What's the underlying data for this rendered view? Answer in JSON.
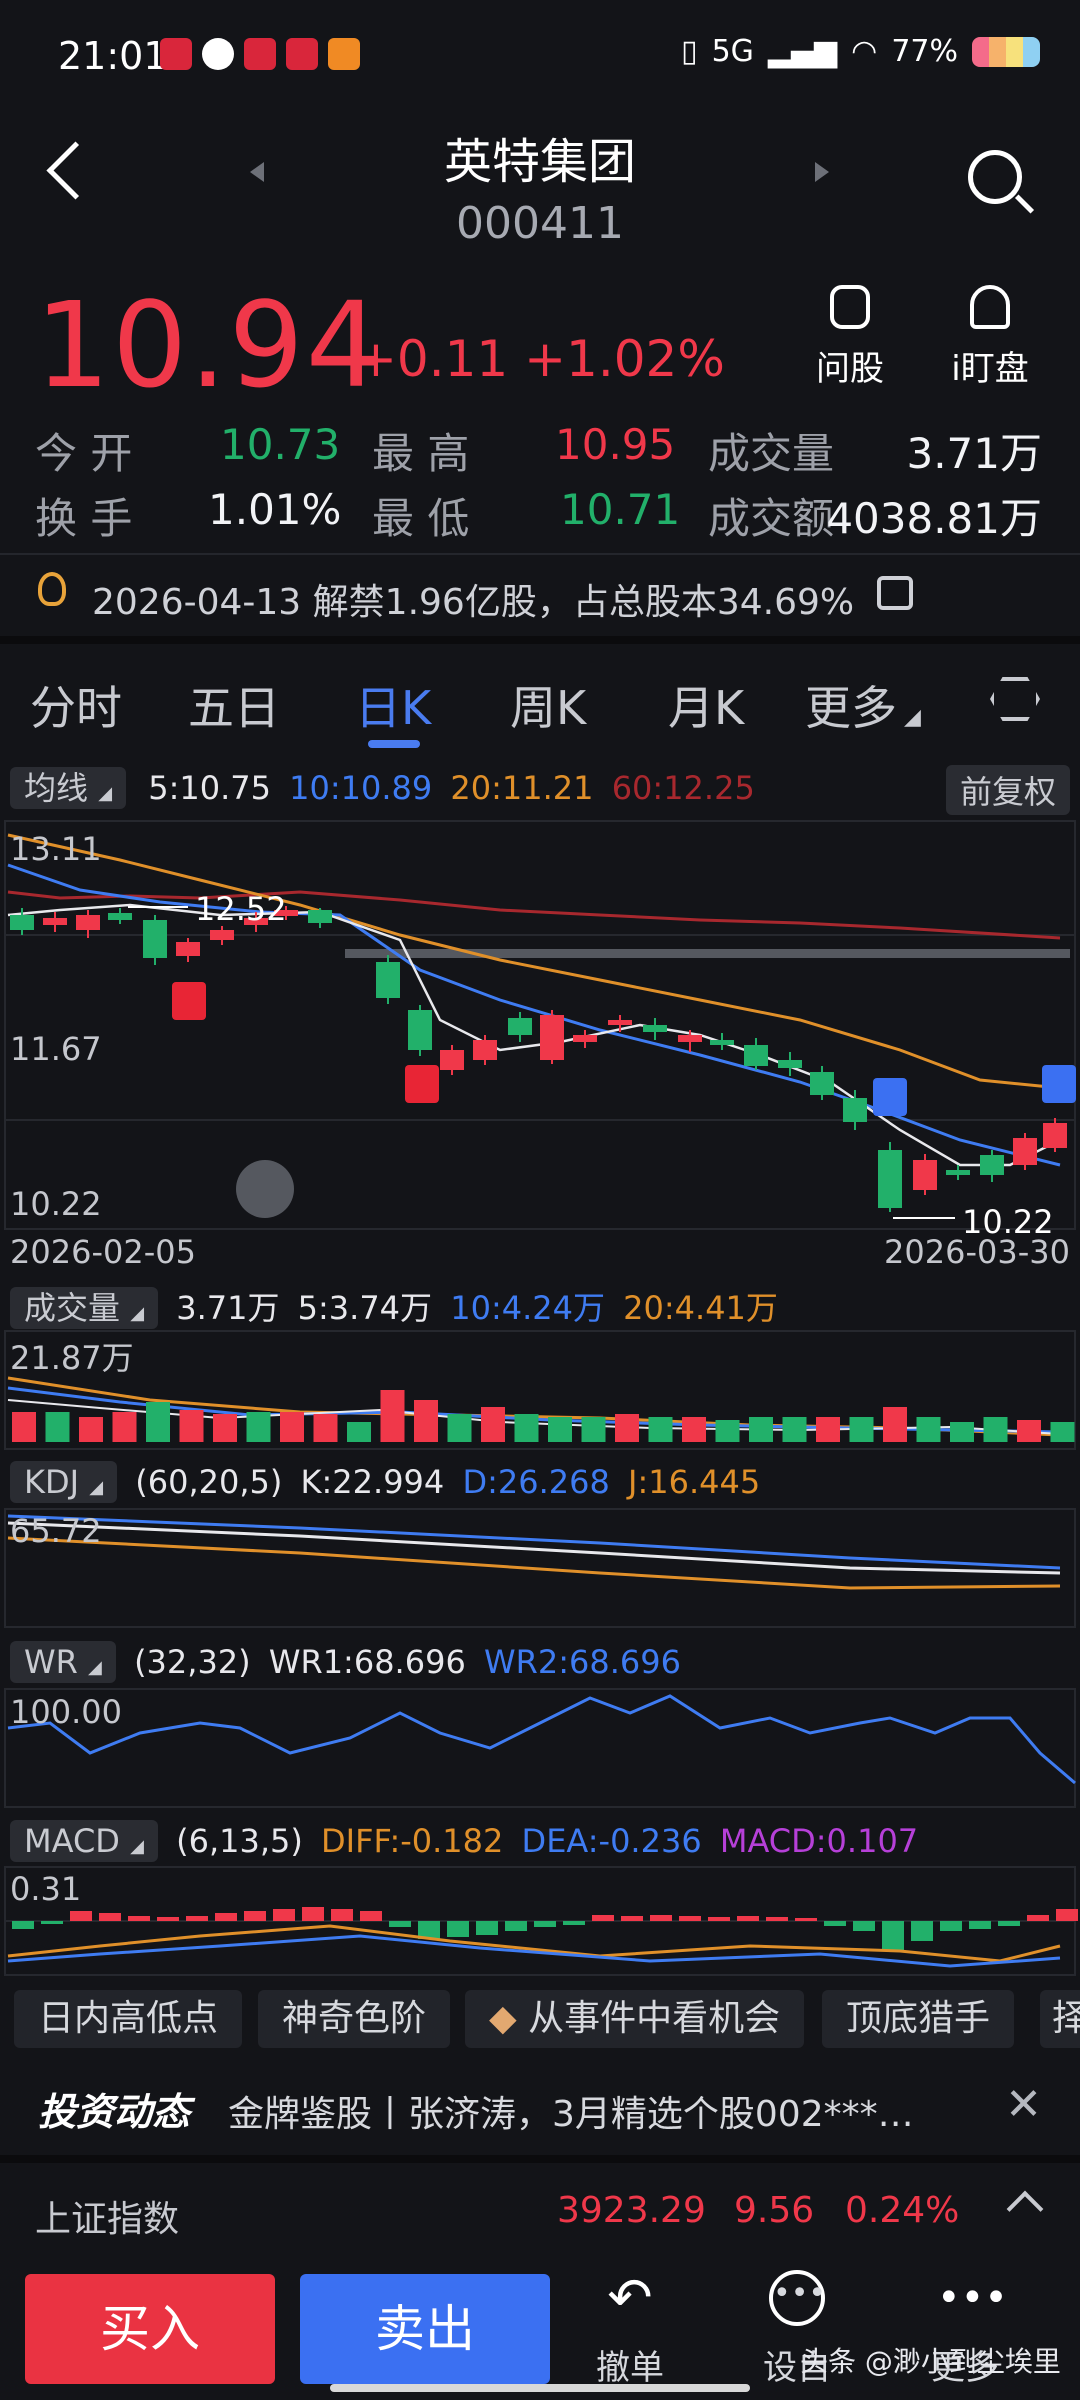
{
  "status_bar": {
    "time": "21:01",
    "battery": "77%",
    "network": "5G"
  },
  "header": {
    "name": "英特集团",
    "code": "000411"
  },
  "quote": {
    "price": "10.94",
    "change": "+0.11",
    "change_pct": "+1.02%",
    "actions": [
      {
        "label": "问股",
        "icon": "person-icon"
      },
      {
        "label": "i盯盘",
        "icon": "bell-icon"
      }
    ]
  },
  "stats": [
    {
      "label": "今 开",
      "value": "10.73",
      "tone": "green"
    },
    {
      "label": "最 高",
      "value": "10.95",
      "tone": "red"
    },
    {
      "label": "成交量",
      "value": "3.71万",
      "tone": "white"
    },
    {
      "label": "换 手",
      "value": "1.01%",
      "tone": "white"
    },
    {
      "label": "最 低",
      "value": "10.71",
      "tone": "green"
    },
    {
      "label": "成交额",
      "value": "4038.81万",
      "tone": "white"
    }
  ],
  "notice": {
    "text": "2026-04-13 解禁1.96亿股，占总股本34.69%"
  },
  "tabs": [
    {
      "label": "分时"
    },
    {
      "label": "五日"
    },
    {
      "label": "日K",
      "active": true
    },
    {
      "label": "周K"
    },
    {
      "label": "月K"
    },
    {
      "label": "更多"
    }
  ],
  "ma_row": {
    "chip": "均线",
    "ma5": "5:10.75",
    "ma10": "10:10.89",
    "ma20": "20:11.21",
    "ma60": "60:12.25",
    "adjust": "前复权"
  },
  "kline": {
    "y_top": "13.11",
    "y_mid": "11.67",
    "y_bottom": "10.22",
    "high_label": "12.52",
    "low_label": "10.22",
    "date_start": "2026-02-05",
    "date_end": "2026-03-30",
    "buy_mark": "B",
    "sell_mark": "S"
  },
  "volume_row": {
    "chip": "成交量",
    "v": "3.71万",
    "ma5": "5:3.74万",
    "ma10": "10:4.24万",
    "ma20": "20:4.41万",
    "y_top": "21.87万"
  },
  "kdj_row": {
    "chip": "KDJ",
    "params": "(60,20,5)",
    "k": "K:22.994",
    "d": "D:26.268",
    "j": "J:16.445",
    "y_top": "65.72"
  },
  "wr_row": {
    "chip": "WR",
    "params": "(32,32)",
    "wr1": "WR1:68.696",
    "wr2": "WR2:68.696",
    "y_top": "100.00"
  },
  "macd_row": {
    "chip": "MACD",
    "params": "(6,13,5)",
    "diff": "DIFF:-0.182",
    "dea": "DEA:-0.236",
    "macd": "MACD:0.107",
    "y_top": "0.31"
  },
  "features": [
    "日内高低点",
    "神奇色阶",
    "从事件中看机会",
    "顶底猎手",
    "择"
  ],
  "news": {
    "brand": "投资动态",
    "text": "金牌鉴股丨张济涛，3月精选个股002***…"
  },
  "index": {
    "name": "上证指数",
    "value": "3923.29",
    "change": "9.56",
    "pct": "0.24%"
  },
  "bottom": {
    "buy": "买入",
    "sell": "卖出",
    "cancel": "撤单",
    "settings": "设自",
    "more": "更多",
    "watermark": "头条 @渺小到尘埃里"
  },
  "colors": {
    "up": "#f0384a",
    "down": "#22b06a",
    "ma5": "#e8e8ec",
    "ma10": "#3f7cf2",
    "ma20": "#e0902a",
    "ma60": "#a8282e",
    "macd": "#b640d8"
  }
}
